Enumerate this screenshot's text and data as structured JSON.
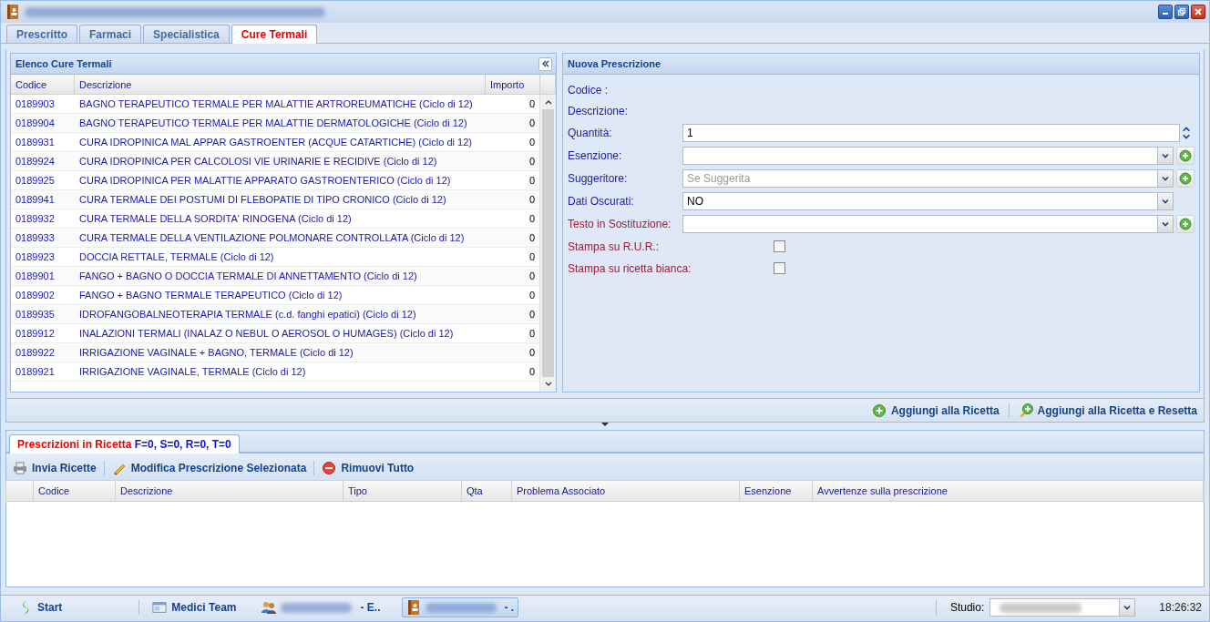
{
  "tabs": [
    {
      "label": "Prescritto",
      "selected": false
    },
    {
      "label": "Farmaci",
      "selected": false
    },
    {
      "label": "Specialistica",
      "selected": false
    },
    {
      "label": "Cure Termali",
      "selected": true
    }
  ],
  "list_panel": {
    "title": "Elenco Cure Termali",
    "columns": [
      "Codice",
      "Descrizione",
      "Importo"
    ],
    "rows": [
      {
        "code": "0189903",
        "description": "BAGNO TERAPEUTICO TERMALE PER MALATTIE ARTROREUMATICHE (Ciclo di 12)",
        "amount": "0"
      },
      {
        "code": "0189904",
        "description": "BAGNO TERAPEUTICO TERMALE PER MALATTIE DERMATOLOGICHE (Ciclo di 12)",
        "amount": "0"
      },
      {
        "code": "0189931",
        "description": "CURA IDROPINICA MAL APPAR GASTROENTER (ACQUE CATARTICHE) (Ciclo di 12)",
        "amount": "0"
      },
      {
        "code": "0189924",
        "description": "CURA IDROPINICA PER CALCOLOSI VIE URINARIE E RECIDIVE (Ciclo di 12)",
        "amount": "0"
      },
      {
        "code": "0189925",
        "description": "CURA IDROPINICA PER MALATTIE APPARATO GASTROENTERICO (Ciclo di 12)",
        "amount": "0"
      },
      {
        "code": "0189941",
        "description": "CURA TERMALE DEI POSTUMI DI FLEBOPATIE DI TIPO CRONICO (Ciclo di 12)",
        "amount": "0"
      },
      {
        "code": "0189932",
        "description": "CURA TERMALE DELLA SORDITA' RINOGENA (Ciclo di 12)",
        "amount": "0"
      },
      {
        "code": "0189933",
        "description": "CURA TERMALE DELLA VENTILAZIONE POLMONARE CONTROLLATA (Ciclo di 12)",
        "amount": "0"
      },
      {
        "code": "0189923",
        "description": "DOCCIA RETTALE, TERMALE (Ciclo di 12)",
        "amount": "0"
      },
      {
        "code": "0189901",
        "description": "FANGO + BAGNO O DOCCIA TERMALE DI ANNETTAMENTO (Ciclo di 12)",
        "amount": "0"
      },
      {
        "code": "0189902",
        "description": "FANGO + BAGNO TERMALE TERAPEUTICO (Ciclo di 12)",
        "amount": "0"
      },
      {
        "code": "0189935",
        "description": "IDROFANGOBALNEOTERAPIA TERMALE (c.d. fanghi epatici) (Ciclo di 12)",
        "amount": "0"
      },
      {
        "code": "0189912",
        "description": "INALAZIONI TERMALI (INALAZ O NEBUL O AEROSOL O HUMAGES) (Ciclo di 12)",
        "amount": "0"
      },
      {
        "code": "0189922",
        "description": "IRRIGAZIONE VAGINALE + BAGNO, TERMALE (Ciclo di 12)",
        "amount": "0"
      },
      {
        "code": "0189921",
        "description": "IRRIGAZIONE VAGINALE, TERMALE (Ciclo di 12)",
        "amount": "0"
      }
    ]
  },
  "form": {
    "title": "Nuova Prescrizione",
    "fields": [
      {
        "kind": "static",
        "label": "Codice :",
        "important": false
      },
      {
        "kind": "static",
        "label": "Descrizione:",
        "important": false
      },
      {
        "kind": "spinner",
        "label": "Quantità:",
        "value": "1",
        "important": false
      },
      {
        "kind": "combo",
        "label": "Esenzione:",
        "add": true,
        "important": false
      },
      {
        "kind": "combo",
        "label": "Suggeritore:",
        "placeholder": "Se Suggerita",
        "add": true,
        "important": false
      },
      {
        "kind": "combo",
        "label": "Dati Oscurati:",
        "value": "NO",
        "add": false,
        "important": false
      },
      {
        "kind": "combo",
        "label": "Testo in Sostituzione:",
        "add": true,
        "important": true
      },
      {
        "kind": "checkbox",
        "label": "Stampa su R.U.R.:",
        "checked": false,
        "important": true
      },
      {
        "kind": "checkbox",
        "label": "Stampa su ricetta bianca:",
        "checked": false,
        "important": true
      }
    ]
  },
  "actions": [
    {
      "kind": "add",
      "label": "Aggiungi alla Ricetta"
    },
    {
      "kind": "add_reset",
      "label": "Aggiungi alla Ricetta e Resetta"
    }
  ],
  "recipe_tab": {
    "label": "Prescrizioni in Ricetta",
    "counts": "F=0, S=0, R=0, T=0",
    "selected": true
  },
  "toolbar": [
    {
      "kind": "print",
      "label": "Invia Ricette"
    },
    {
      "kind": "edit",
      "label": "Modifica Prescrizione Selezionata"
    },
    {
      "kind": "remove",
      "label": "Rimuovi Tutto"
    }
  ],
  "recipe_columns": [
    "Codice",
    "Descrizione",
    "Tipo",
    "Qta",
    "Problema Associato",
    "Esenzione",
    "Avvertenze sulla prescrizione"
  ],
  "taskbar": {
    "start": "Start",
    "items": [
      {
        "kind": "app",
        "label": "Medici Team",
        "selected": false
      },
      {
        "kind": "users",
        "label": "- E..",
        "selected": false
      },
      {
        "kind": "book",
        "label": "- .",
        "selected": true
      }
    ],
    "studio_label": "Studio:",
    "time": "18:26:32"
  }
}
